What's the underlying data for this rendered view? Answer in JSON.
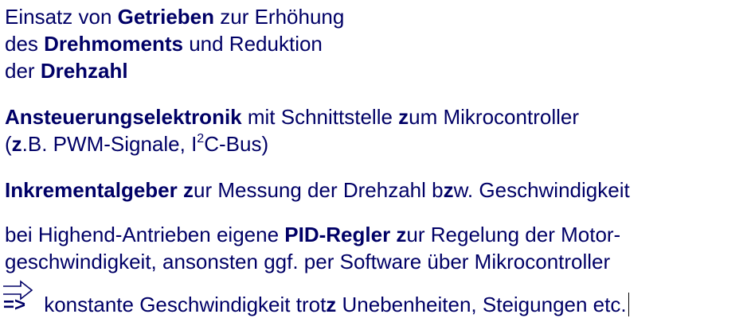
{
  "paragraphs": {
    "p1": {
      "line1_a": "Einsatz von ",
      "line1_b": "Getrieben",
      "line1_c": " zur Erhöhung",
      "line2_a": "des ",
      "line2_b": "Drehmoments",
      "line2_c": " und Reduktion",
      "line3_a": "der ",
      "line3_b": "Drehzahl"
    },
    "p2": {
      "line1_a": "Ansteuerungselektronik",
      "line1_b": " mit Schnittstelle ",
      "line1_c": "z",
      "line1_d": "um Mikrocontroller",
      "line2_a": "(",
      "line2_b": "z",
      "line2_c": ".B. PWM-Signale, I",
      "line2_sup": "2",
      "line2_d": "C-Bus)"
    },
    "p3": {
      "line1_a": "Inkrementalgeber",
      "line1_b": " ",
      "line1_c": "z",
      "line1_d": "ur Messung der Drehzahl b",
      "line1_e": "z",
      "line1_f": "w. Geschwindigkeit"
    },
    "p4": {
      "line1_a": "bei Highend-Antrieben eigene ",
      "line1_b": "PID-Regler",
      "line1_c": " ",
      "line1_d": "z",
      "line1_e": "ur Regelung der Motor-",
      "line2_a": "geschwindigkeit, ansonsten ggf. per Software über Mikrocontroller"
    },
    "p5": {
      "arrow_text": "=>",
      "line1_a": " konstante Geschwindigkeit trot",
      "line1_b": "z",
      "line1_c": " Unebenheiten, Steigungen etc."
    }
  },
  "colors": {
    "text": "#000066",
    "background": "#ffffff"
  },
  "icons": {
    "arrow": "double-right-arrow-icon"
  }
}
